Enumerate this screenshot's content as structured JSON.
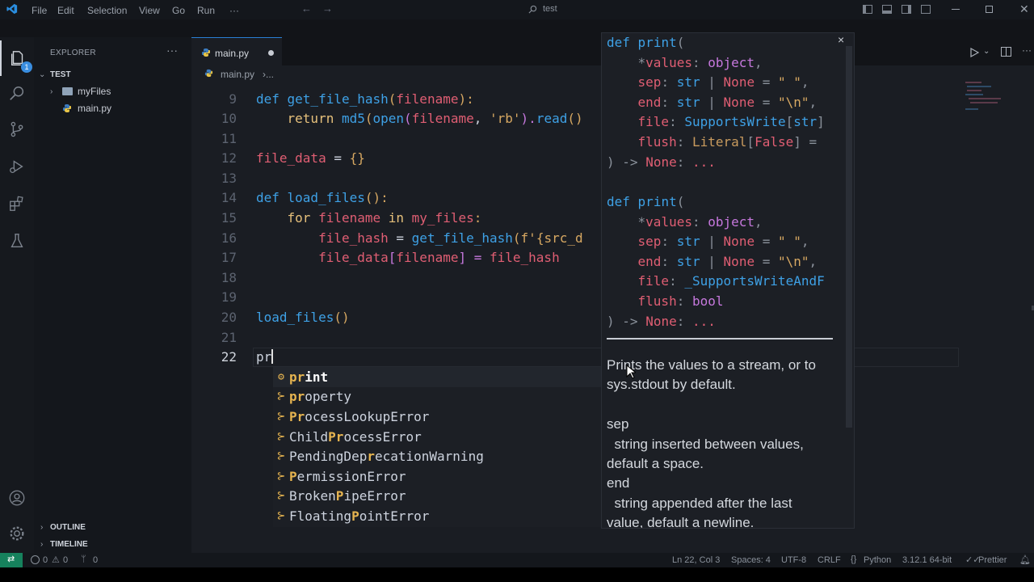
{
  "menu": [
    "File",
    "Edit",
    "Selection",
    "View",
    "Go",
    "Run",
    "···"
  ],
  "search": "test",
  "explorer": {
    "title": "EXPLORER",
    "root": "TEST",
    "items": [
      "myFiles",
      "main.py"
    ],
    "outline": "OUTLINE",
    "timeline": "TIMELINE"
  },
  "activity_badge": "1",
  "tab": {
    "label": "main.py"
  },
  "breadcrumb": {
    "file": "main.py",
    "rest": "›..."
  },
  "gutter": [
    "9",
    "10",
    "11",
    "12",
    "13",
    "14",
    "15",
    "16",
    "17",
    "18",
    "19",
    "20",
    "21",
    "22"
  ],
  "code": {
    "l9a": "def ",
    "l9b": "get_file_hash",
    "l9c": "(",
    "l9d": "filename",
    "l9e": "):",
    "l10a": "    return ",
    "l10b": "md5",
    "l10c": "(",
    "l10d": "open",
    "l10e": "(",
    "l10f": "filename",
    "l10g": ", ",
    "l10h": "'rb'",
    "l10i": ").",
    "l10j": "read",
    "l10k": "()",
    "l12a": "file_data",
    "l12b": " = ",
    "l12c": "{}",
    "l14a": "def ",
    "l14b": "load_files",
    "l14c": "():",
    "l15a": "    for ",
    "l15b": "filename",
    "l15c": " in ",
    "l15d": "my_files",
    "l15e": ":",
    "l16a": "        file_hash",
    "l16b": " = ",
    "l16c": "get_file_hash",
    "l16d": "(",
    "l16e": "f'{src_d",
    "l17a": "        file_data",
    "l17b": "[",
    "l17c": "filename",
    "l17d": "] = ",
    "l17e": "file_hash",
    "l20a": "load_files",
    "l20b": "()",
    "l22a": "pr"
  },
  "suggestions": [
    {
      "icon": "⚙",
      "pre": "",
      "hl": "pr",
      "post": "int"
    },
    {
      "icon": "⊱",
      "pre": "",
      "hl": "pr",
      "post": "operty"
    },
    {
      "icon": "⊱",
      "pre": "",
      "hl": "Pr",
      "post": "ocessLookupError"
    },
    {
      "icon": "⊱",
      "pre": "Child",
      "hl": "Pr",
      "post": "ocessError"
    },
    {
      "icon": "⊱",
      "pre": "PendingDep",
      "hl": "r",
      "post": "ecationWarning"
    },
    {
      "icon": "⊱",
      "pre": "",
      "hl": "P",
      "post": "ermissionError"
    },
    {
      "icon": "⊱",
      "pre": "Broken",
      "hl": "P",
      "post": "ipeError"
    },
    {
      "icon": "⊱",
      "pre": "Floating",
      "hl": "P",
      "post": "ointError"
    }
  ],
  "doc": {
    "sig1": [
      "def print(",
      "    *values: object,",
      "    sep: str | None = \" \",",
      "    end: str | None = \"\\n\",",
      "    file: SupportsWrite[str]",
      "    flush: Literal[False] =",
      ") -> None: ..."
    ],
    "sig2": [
      "def print(",
      "    *values: object,",
      "    sep: str | None = \" \",",
      "    end: str | None = \"\\n\",",
      "    file: _SupportsWriteAndF",
      "    flush: bool",
      ") -> None: ..."
    ],
    "desc": [
      "Prints the values to a stream, or to",
      "sys.stdout by default.",
      "",
      "sep",
      "  string inserted between values,",
      "default a space.",
      "end",
      "  string appended after the last",
      "value, default a newline."
    ]
  },
  "status": {
    "errors": "0",
    "warnings": "0",
    "ports": "0",
    "position": "Ln 22, Col 3",
    "spaces": "Spaces: 4",
    "encoding": "UTF-8",
    "eol": "CRLF",
    "language": "Python",
    "interpreter": "3.12.1 64-bit",
    "formatter": "Prettier"
  },
  "colors": {
    "accent": "#2a7fd4",
    "keyword": "#3ea1e6",
    "variable": "#e05e73",
    "string": "#d7a862",
    "match": "#e6b450"
  }
}
